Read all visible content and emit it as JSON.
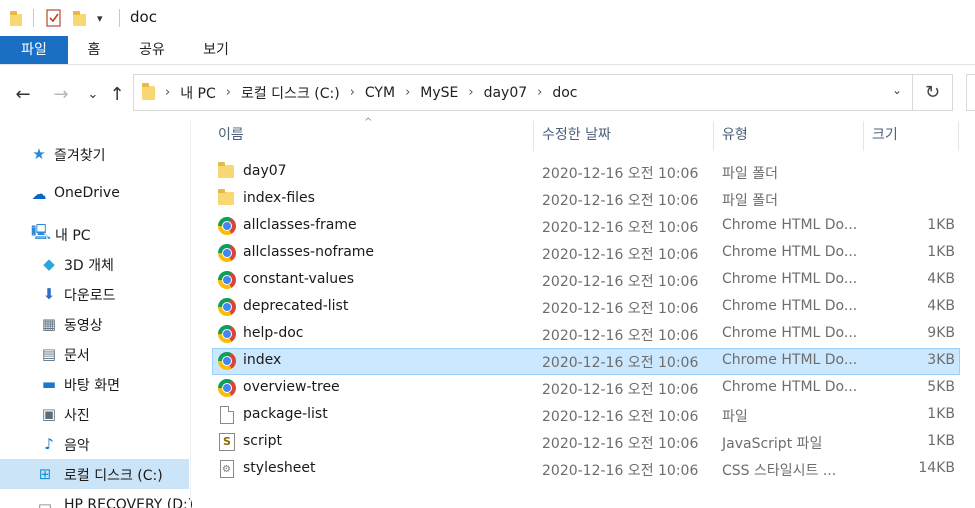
{
  "window": {
    "title": "doc"
  },
  "quick_access": {
    "folder_icon": "folder-icon",
    "properties_icon": "checklist-icon",
    "new_folder_icon": "folder-icon",
    "customize_icon": "dropdown-arrow-icon",
    "customize_glyph": "▾"
  },
  "ribbon": {
    "tabs": [
      "파일",
      "홈",
      "공유",
      "보기"
    ],
    "accent": "#1a6fc2"
  },
  "nav": {
    "back_glyph": "←",
    "forward_glyph": "→",
    "recent_glyph": "⌄",
    "up_glyph": "↑",
    "refresh_glyph": "↻",
    "dropdown_glyph": "⌄",
    "separator_glyph": "›"
  },
  "address": {
    "segments": [
      "내 PC",
      "로컬 디스크 (C:)",
      "CYM",
      "MySE",
      "day07",
      "doc"
    ]
  },
  "sidebar": {
    "items": [
      {
        "label": "즐겨찾기",
        "icon": "star-icon",
        "glyph": "★",
        "color": "#2b88d8"
      },
      {
        "label": "OneDrive",
        "icon": "cloud-icon",
        "glyph": "☁",
        "color": "#0a64c8"
      },
      {
        "label": "내 PC",
        "icon": "computer-icon",
        "glyph": "🖳",
        "color": "#2b88d8"
      },
      {
        "label": "3D 개체",
        "icon": "cube-icon",
        "glyph": "◆",
        "color": "#2aa6d8"
      },
      {
        "label": "다운로드",
        "icon": "download-arrow-icon",
        "glyph": "⬇",
        "color": "#2b6fc2"
      },
      {
        "label": "동영상",
        "icon": "film-icon",
        "glyph": "▦",
        "color": "#5a6d7d"
      },
      {
        "label": "문서",
        "icon": "document-icon",
        "glyph": "▤",
        "color": "#5a6d7d"
      },
      {
        "label": "바탕 화면",
        "icon": "desktop-icon",
        "glyph": "▬",
        "color": "#1a78c8"
      },
      {
        "label": "사진",
        "icon": "picture-icon",
        "glyph": "▣",
        "color": "#5a6d7d"
      },
      {
        "label": "음악",
        "icon": "music-note-icon",
        "glyph": "♪",
        "color": "#1a78c8"
      },
      {
        "label": "로컬 디스크 (C:)",
        "icon": "windows-drive-icon",
        "glyph": "⊞",
        "color": "#1a90d8",
        "selected": true
      },
      {
        "label": "HP RECOVERY (D:)",
        "icon": "drive-icon",
        "glyph": "▭",
        "color": "#777777"
      }
    ]
  },
  "columns": {
    "name": "이름",
    "date": "수정한 날짜",
    "type": "유형",
    "size": "크기",
    "sort_glyph": "^"
  },
  "files": [
    {
      "name": "day07",
      "date": "2020-12-16 오전 10:06",
      "type": "파일 폴더",
      "size": "",
      "icon": "folder-icon"
    },
    {
      "name": "index-files",
      "date": "2020-12-16 오전 10:06",
      "type": "파일 폴더",
      "size": "",
      "icon": "folder-icon"
    },
    {
      "name": "allclasses-frame",
      "date": "2020-12-16 오전 10:06",
      "type": "Chrome HTML Do...",
      "size": "1KB",
      "icon": "chrome-icon"
    },
    {
      "name": "allclasses-noframe",
      "date": "2020-12-16 오전 10:06",
      "type": "Chrome HTML Do...",
      "size": "1KB",
      "icon": "chrome-icon"
    },
    {
      "name": "constant-values",
      "date": "2020-12-16 오전 10:06",
      "type": "Chrome HTML Do...",
      "size": "4KB",
      "icon": "chrome-icon"
    },
    {
      "name": "deprecated-list",
      "date": "2020-12-16 오전 10:06",
      "type": "Chrome HTML Do...",
      "size": "4KB",
      "icon": "chrome-icon"
    },
    {
      "name": "help-doc",
      "date": "2020-12-16 오전 10:06",
      "type": "Chrome HTML Do...",
      "size": "9KB",
      "icon": "chrome-icon"
    },
    {
      "name": "index",
      "date": "2020-12-16 오전 10:06",
      "type": "Chrome HTML Do...",
      "size": "3KB",
      "icon": "chrome-icon",
      "selected": true
    },
    {
      "name": "overview-tree",
      "date": "2020-12-16 오전 10:06",
      "type": "Chrome HTML Do...",
      "size": "5KB",
      "icon": "chrome-icon"
    },
    {
      "name": "package-list",
      "date": "2020-12-16 오전 10:06",
      "type": "파일",
      "size": "1KB",
      "icon": "blank-file-icon"
    },
    {
      "name": "script",
      "date": "2020-12-16 오전 10:06",
      "type": "JavaScript 파일",
      "size": "1KB",
      "icon": "script-file-icon"
    },
    {
      "name": "stylesheet",
      "date": "2020-12-16 오전 10:06",
      "type": "CSS 스타일시트 ...",
      "size": "14KB",
      "icon": "css-file-icon"
    }
  ],
  "colors": {
    "selection_bg": "#cce8ff",
    "selection_border": "#99d1ff",
    "sidebar_selected_bg": "#cce4f7"
  }
}
